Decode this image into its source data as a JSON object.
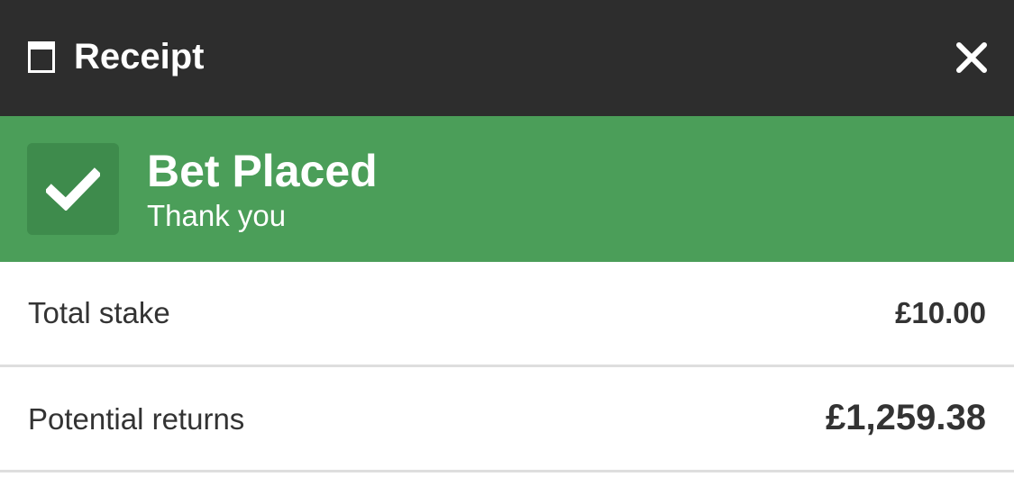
{
  "header": {
    "title": "Receipt",
    "icon": "receipt-icon",
    "close_icon": "close-icon",
    "background_color": "#2d2d2d"
  },
  "banner": {
    "title": "Bet Placed",
    "subtitle": "Thank you",
    "icon": "checkmark-icon",
    "background_color": "#4b9e59"
  },
  "summary": {
    "rows": [
      {
        "label": "Total stake",
        "value": "£10.00"
      },
      {
        "label": "Potential returns",
        "value": "£1,259.38"
      }
    ]
  }
}
